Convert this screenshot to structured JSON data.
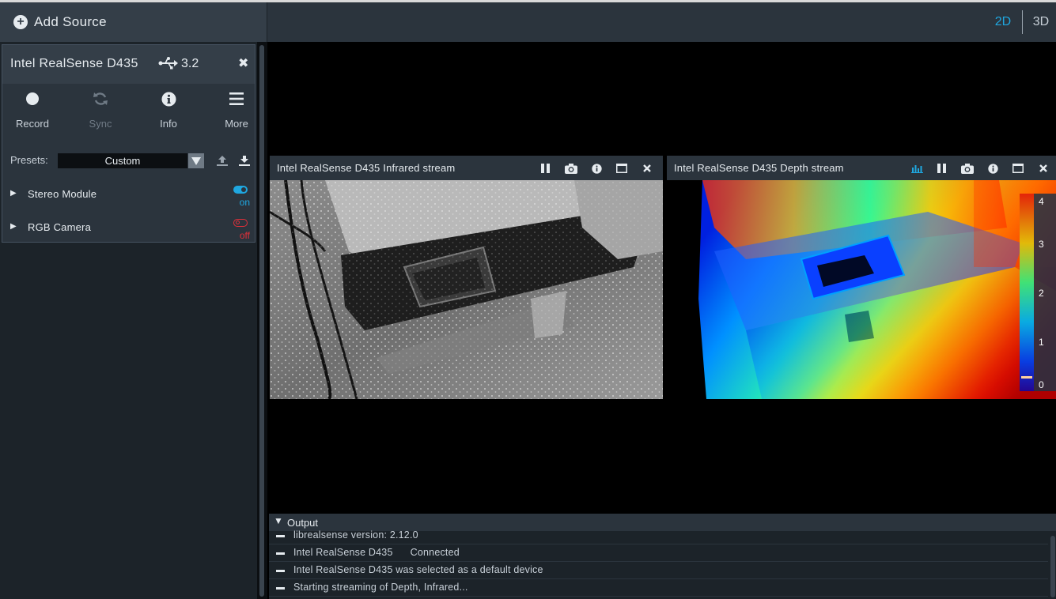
{
  "toolbar": {
    "add_source_label": "Add Source",
    "add_source_icon": "plus-circle-icon",
    "mode_2d": "2D",
    "mode_3d": "3D",
    "active_mode_color": "#1fa7e0"
  },
  "device": {
    "name": "Intel RealSense D435",
    "usb_icon": "usb-icon",
    "usb_version": "3.2",
    "close_icon": "close-icon",
    "tools": [
      {
        "label": "Record",
        "icon": "record-icon",
        "enabled": true
      },
      {
        "label": "Sync",
        "icon": "sync-icon",
        "enabled": false
      },
      {
        "label": "Info",
        "icon": "info-icon",
        "enabled": true
      },
      {
        "label": "More",
        "icon": "hamburger-menu-icon",
        "enabled": true
      }
    ],
    "presets": {
      "label": "Presets:",
      "selected": "Custom",
      "upload_icon": "upload-icon",
      "download_icon": "download-icon"
    },
    "sensors": [
      {
        "name": "Stereo Module",
        "state": "on",
        "color": "#1fa7e0"
      },
      {
        "name": "RGB Camera",
        "state": "off",
        "color": "#e0303a"
      }
    ]
  },
  "streams": [
    {
      "title": "Intel RealSense D435 Infrared stream",
      "icons": [
        "pause-icon",
        "camera-icon",
        "info-icon",
        "maximize-icon",
        "close-icon"
      ]
    },
    {
      "title": "Intel RealSense D435 Depth stream",
      "icons": [
        "histogram-icon",
        "pause-icon",
        "camera-icon",
        "info-icon",
        "maximize-icon",
        "close-icon"
      ],
      "colorbar_ticks": [
        "4",
        "3",
        "2",
        "1",
        "0"
      ]
    }
  ],
  "output": {
    "title": "Output",
    "lines": [
      "librealsense version: 2.12.0",
      "Intel RealSense D435      Connected",
      "Intel RealSense D435 was selected as a default device",
      "Starting streaming of Depth, Infrared..."
    ]
  }
}
